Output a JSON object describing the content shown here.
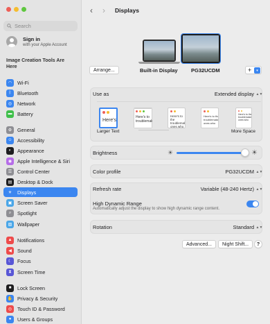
{
  "colors": {
    "accent": "#3b86f0",
    "close": "#ee5f57",
    "minimize": "#f5bd2f",
    "zoom": "#5fc73f"
  },
  "sidebar": {
    "search_placeholder": "Search",
    "account": {
      "title": "Sign in",
      "subtitle": "with your Apple Account"
    },
    "promo": "Image Creation Tools Are Here",
    "items": [
      {
        "label": "Wi-Fi",
        "icon": "wifi-icon",
        "color": "#3b86f0"
      },
      {
        "label": "Bluetooth",
        "icon": "bluetooth-icon",
        "color": "#3b86f0"
      },
      {
        "label": "Network",
        "icon": "globe-icon",
        "color": "#3b86f0"
      },
      {
        "label": "Battery",
        "icon": "battery-icon",
        "color": "#3fbf4a"
      },
      {
        "label": "General",
        "icon": "gear-icon",
        "color": "#8e8e93"
      },
      {
        "label": "Accessibility",
        "icon": "accessibility-icon",
        "color": "#3b86f0"
      },
      {
        "label": "Appearance",
        "icon": "appearance-icon",
        "color": "#1d1d1f"
      },
      {
        "label": "Apple Intelligence & Siri",
        "icon": "siri-icon",
        "color": "#b66de8"
      },
      {
        "label": "Control Center",
        "icon": "control-center-icon",
        "color": "#8e8e93"
      },
      {
        "label": "Desktop & Dock",
        "icon": "dock-icon",
        "color": "#1d1d1f"
      },
      {
        "label": "Displays",
        "icon": "sun-icon",
        "color": "#3b86f0"
      },
      {
        "label": "Screen Saver",
        "icon": "screen-saver-icon",
        "color": "#4aa6e8"
      },
      {
        "label": "Spotlight",
        "icon": "search-icon",
        "color": "#8e8e93"
      },
      {
        "label": "Wallpaper",
        "icon": "wallpaper-icon",
        "color": "#4aa6e8"
      },
      {
        "label": "Notifications",
        "icon": "bell-icon",
        "color": "#ee4b4b"
      },
      {
        "label": "Sound",
        "icon": "speaker-icon",
        "color": "#ee4b4b"
      },
      {
        "label": "Focus",
        "icon": "moon-icon",
        "color": "#5856d6"
      },
      {
        "label": "Screen Time",
        "icon": "hourglass-icon",
        "color": "#5856d6"
      },
      {
        "label": "Lock Screen",
        "icon": "lock-icon",
        "color": "#1d1d1f"
      },
      {
        "label": "Privacy & Security",
        "icon": "hand-icon",
        "color": "#3b86f0"
      },
      {
        "label": "Touch ID & Password",
        "icon": "fingerprint-icon",
        "color": "#ee4b4b"
      },
      {
        "label": "Users & Groups",
        "icon": "users-icon",
        "color": "#3b86f0"
      }
    ]
  },
  "header": {
    "title": "Displays"
  },
  "arrangement": {
    "arrange_button": "Arrange...",
    "builtin_label": "Built-in Display",
    "external_label": "PG32UCDM",
    "add_button": "+"
  },
  "settings": {
    "use_as": {
      "label": "Use as",
      "value": "Extended display"
    },
    "resolution": {
      "left_label": "Larger Text",
      "right_label": "More Space",
      "sample_text": "Here's",
      "sample_text_2": "Here's to troublemakers",
      "sample_text_3": "Here's to the troublemakers ones who"
    },
    "brightness": {
      "label": "Brightness",
      "level": 0.97
    },
    "color_profile": {
      "label": "Color profile",
      "value": "PG32UCDM"
    },
    "refresh_rate": {
      "label": "Refresh rate",
      "value": "Variable (48-240 Hertz)"
    },
    "hdr": {
      "label": "High Dynamic Range",
      "description": "Automatically adjust the display to show high dynamic range content.",
      "enabled": true
    },
    "rotation": {
      "label": "Rotation",
      "value": "Standard"
    }
  },
  "footer": {
    "advanced_button": "Advanced...",
    "night_shift_button": "Night Shift...",
    "help_button": "?"
  }
}
